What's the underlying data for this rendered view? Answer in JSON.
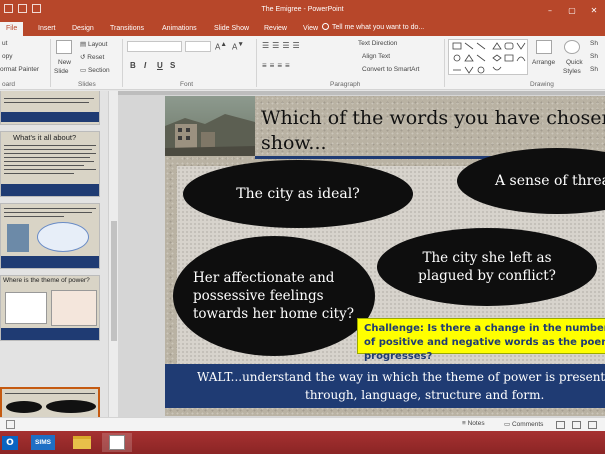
{
  "window": {
    "title": "The Emigree - PowerPoint",
    "minimize": "–",
    "restore": "▢",
    "close": "✕"
  },
  "tabs": [
    "File",
    "Insert",
    "Design",
    "Transitions",
    "Animations",
    "Slide Show",
    "Review",
    "View"
  ],
  "tell_me": "Tell me what you want to do...",
  "ribbon": {
    "clipboard": {
      "cut": "ut",
      "copy": "opy",
      "format_painter": "ormat Painter",
      "label": "oard"
    },
    "slides": {
      "new_slide": "New",
      "new_slide_2": "Slide",
      "layout": "Layout",
      "reset": "Reset",
      "section": "Section",
      "label": "Slides"
    },
    "font": {
      "bold": "B",
      "italic": "I",
      "underline": "U",
      "strike": "S",
      "label": "Font"
    },
    "paragraph": {
      "text_direction": "Text Direction",
      "align_text": "Align Text",
      "smartart": "Convert to SmartArt",
      "label": "Paragraph"
    },
    "drawing": {
      "arrange": "Arrange",
      "quick_styles_1": "Quick",
      "quick_styles_2": "Styles",
      "sh1": "Sh",
      "sh2": "Sh",
      "sh3": "Sh",
      "label": "Drawing"
    }
  },
  "thumbnails": [
    {
      "title": ""
    },
    {
      "title": "What's it all about?"
    },
    {
      "title": ""
    },
    {
      "title": "Where is the theme of power?"
    },
    {
      "title": ""
    }
  ],
  "slide": {
    "title": "Which of the words you have chosen show...",
    "ovals": [
      {
        "text": "The city as ideal?"
      },
      {
        "text": "A sense of threat?"
      },
      {
        "text": "Her affectionate and possessive feelings towards her home city?"
      },
      {
        "text": "The city she left as plagued by conflict?"
      }
    ],
    "challenge": "Challenge: Is there a change in the number of positive and negative words as the poem progresses?",
    "walt_line1": "WALT...understand the way in which the theme of power is presented",
    "walt_line2": "through, language, structure and form."
  },
  "status": {
    "notes": "Notes",
    "comments": "Comments"
  },
  "taskbar": {
    "sims_label": "SIMS"
  },
  "colors": {
    "accent": "#b7472a",
    "slide_navy": "#1f3b73",
    "challenge_yellow": "#ffff00",
    "taskbar": "#8b2525"
  }
}
